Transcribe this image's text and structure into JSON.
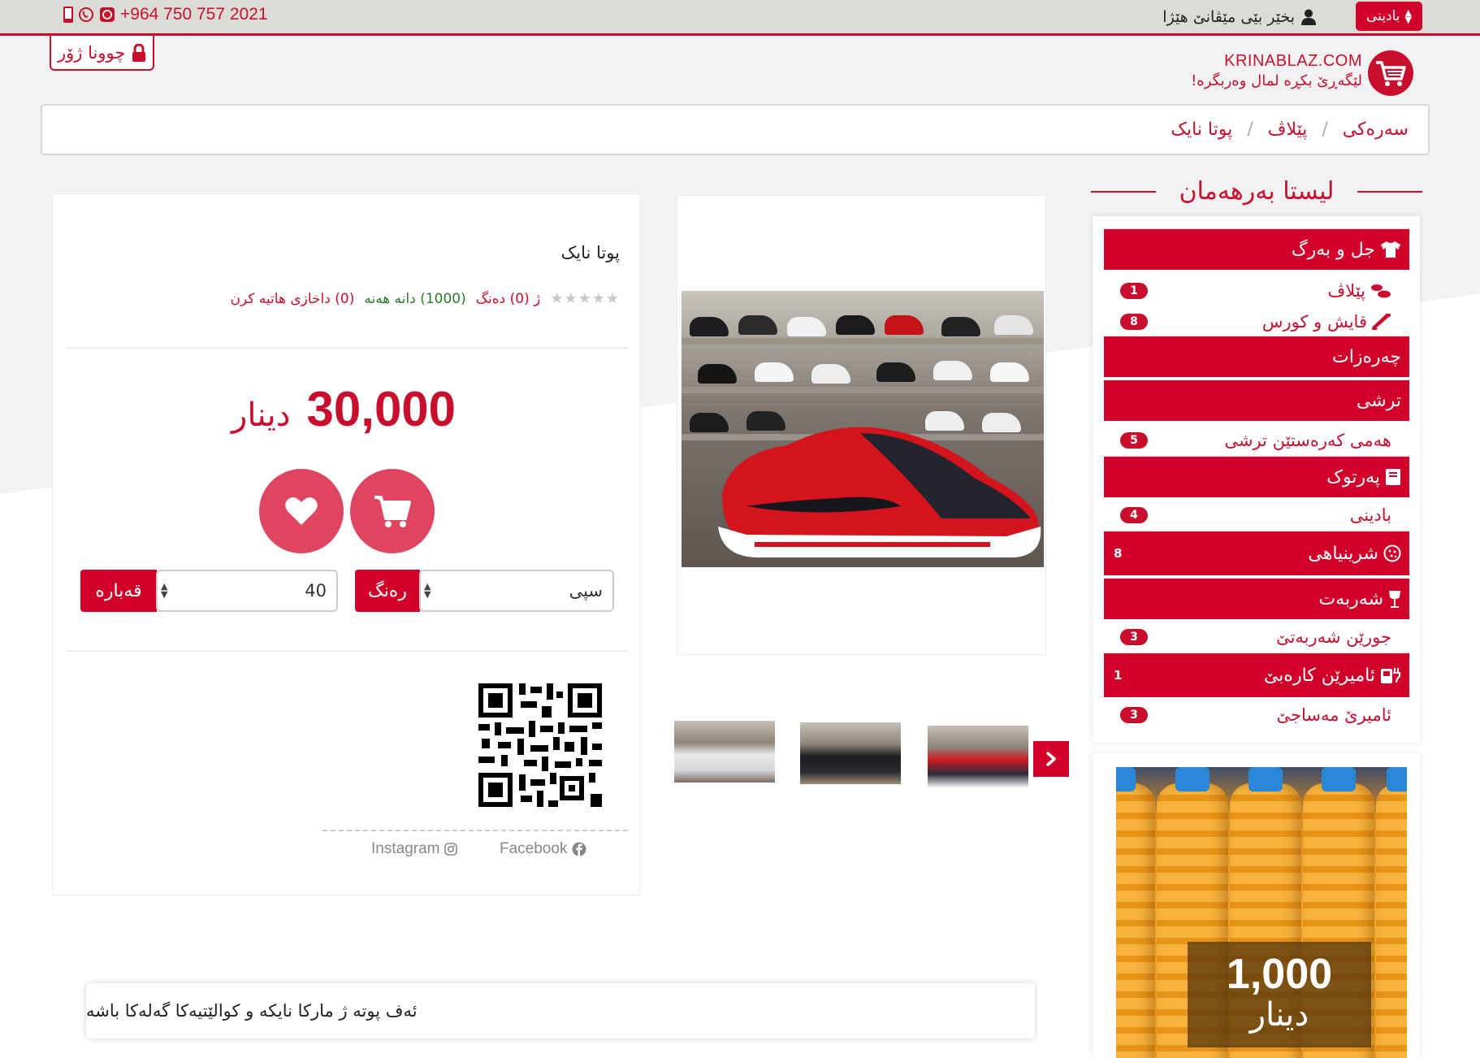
{
  "topbar": {
    "phone": "+964 750 757 2021",
    "welcome": "بخێر بێی مێڤانێ هێژا",
    "language": "بادینی"
  },
  "header": {
    "login": "چوونا ژۆر",
    "domain": "KRINABLAZ.COM",
    "slogan": "لێگەڕێ بکڕە لمال وەربگرە!"
  },
  "breadcrumb": [
    "سەرەکی",
    "پێلاڤ",
    "پوتا نایک"
  ],
  "sidebar": {
    "title": "لیستا بەرهەمان",
    "categories": [
      {
        "label": "جل و بەرگ",
        "icon": "shirt-icon"
      },
      {
        "label": "پێلاڤ",
        "count": "1",
        "icon": "shoe-icon"
      },
      {
        "label": "قایش و کورس",
        "count": "8",
        "icon": "belt-icon"
      },
      {
        "label": "چەرەزات"
      },
      {
        "label": "ترشی"
      },
      {
        "label": "هەمی کەرەستێن ترشی",
        "count": "5"
      },
      {
        "label": "پەرتوک",
        "icon": "book-icon"
      },
      {
        "label": "بادینی",
        "count": "4"
      },
      {
        "label": "شرینیاهی",
        "count": "8",
        "icon": "cookie-icon"
      },
      {
        "label": "شەربەت",
        "icon": "glass-icon"
      },
      {
        "label": "جورێن شەربەتێ",
        "count": "3"
      },
      {
        "label": "ئامیرێن کارەبێ",
        "count": "1",
        "icon": "appliance-icon"
      },
      {
        "label": "ئامیرێ مەساجێ",
        "count": "3"
      }
    ]
  },
  "ad": {
    "price": "1,000",
    "currency": "دینار"
  },
  "product": {
    "name": "پوتا نایک",
    "colors_text": "ژ (0) دەنگ",
    "stock_text": "(1000) دانه هەنه",
    "orders_text": "(0) داخازی هاتیه کرن",
    "rating": 0,
    "price": "30,000",
    "currency": "دینار",
    "color_label": "رەنگ",
    "color_value": "سپی",
    "size_label": "قەبارە",
    "size_value": "40",
    "description": "ئەف پوتە ژ مارکا نایکە و کوالێتیەکا گەلەکا باشە"
  },
  "social": {
    "facebook": "Facebook",
    "instagram": "Instagram"
  },
  "colors": {
    "brand_red": "#d1002a",
    "cart_pink": "#e0455f"
  }
}
